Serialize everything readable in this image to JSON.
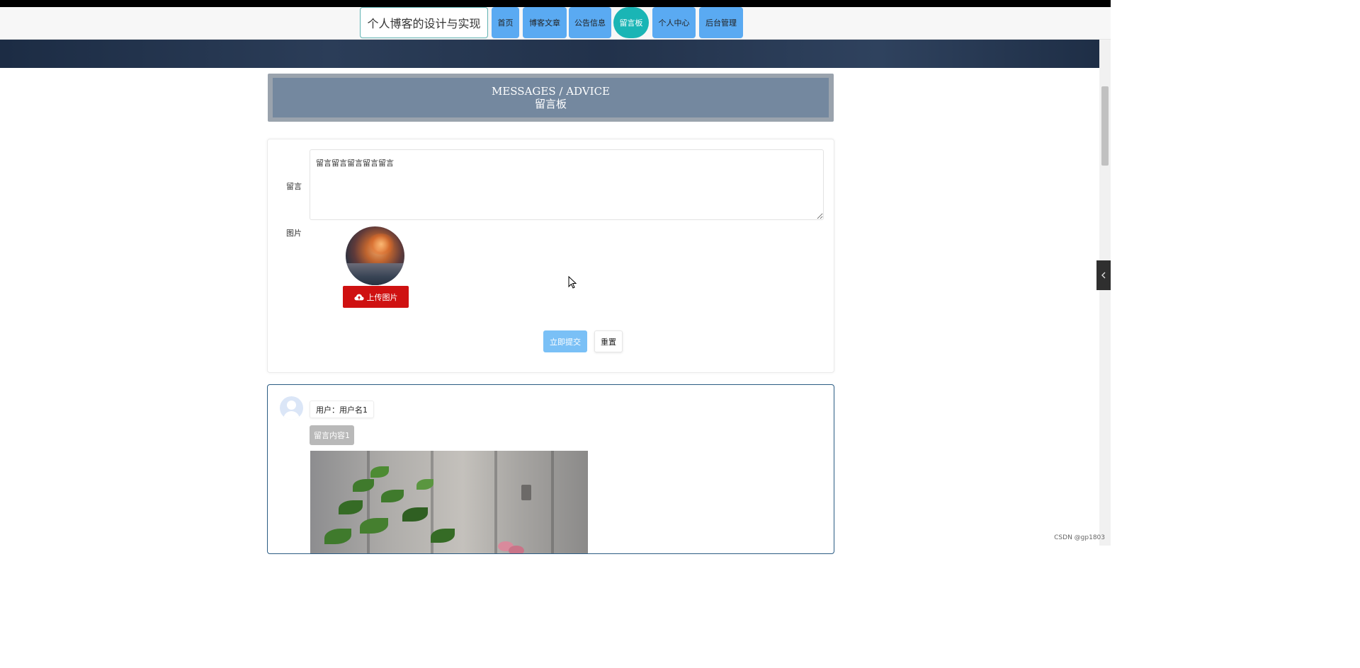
{
  "nav": {
    "site_title": "个人博客的设计与实现",
    "items": [
      {
        "label": "首页",
        "active": false
      },
      {
        "label": "博客文章",
        "active": false
      },
      {
        "label": "公告信息",
        "active": false
      },
      {
        "label": "留言板",
        "active": true
      },
      {
        "label": "个人中心",
        "active": false
      },
      {
        "label": "后台管理",
        "active": false
      }
    ]
  },
  "section": {
    "title_en": "MESSAGES / ADVICE",
    "title_cn": "留言板"
  },
  "form": {
    "message_label": "留言",
    "message_value": "留言留言留言留言留言",
    "image_label": "图片",
    "upload_label": "上传图片",
    "submit_label": "立即提交",
    "reset_label": "重置"
  },
  "messages": [
    {
      "user": "用户：用户名1",
      "content": "留言内容1"
    }
  ],
  "watermark": "CSDN @gp1803",
  "colors": {
    "nav_button": "#5aaaf2",
    "nav_active": "#1ab5b5",
    "header_bg": "#74889f",
    "upload_button": "#cf1111",
    "submit_button": "#7ac0f6",
    "message_border": "#2a5b83"
  },
  "icons": {
    "upload": "cloud-upload-icon",
    "side_toggle": "chevron-left-icon",
    "default_avatar": "user-avatar-icon"
  }
}
